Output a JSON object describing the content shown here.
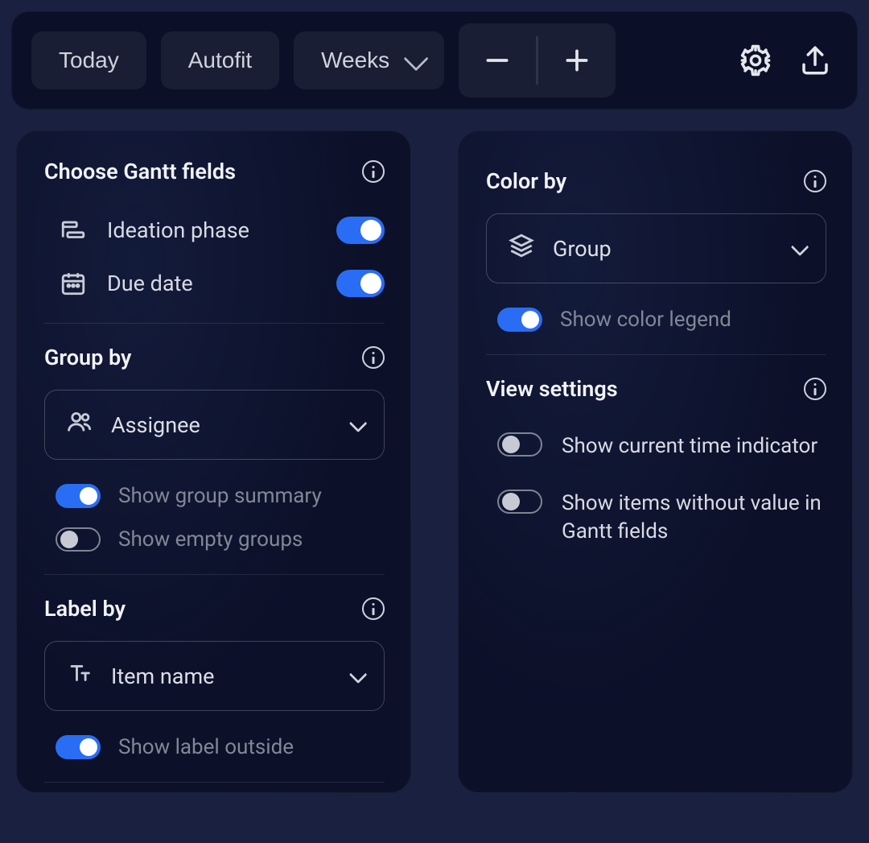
{
  "toolbar": {
    "today_label": "Today",
    "autofit_label": "Autofit",
    "timescale_label": "Weeks"
  },
  "left_panel": {
    "gantt_fields": {
      "title": "Choose Gantt fields",
      "items": [
        {
          "label": "Ideation phase",
          "on": true,
          "icon": "timeline"
        },
        {
          "label": "Due date",
          "on": true,
          "icon": "calendar"
        }
      ]
    },
    "group_by": {
      "title": "Group by",
      "selected": "Assignee",
      "show_group_summary_label": "Show group summary",
      "show_group_summary_on": true,
      "show_empty_groups_label": "Show empty groups",
      "show_empty_groups_on": false
    },
    "label_by": {
      "title": "Label by",
      "selected": "Item name",
      "show_label_outside_label": "Show label outside",
      "show_label_outside_on": true
    }
  },
  "right_panel": {
    "color_by": {
      "title": "Color by",
      "selected": "Group",
      "show_color_legend_label": "Show color legend",
      "show_color_legend_on": true
    },
    "view_settings": {
      "title": "View settings",
      "show_current_time_label": "Show current time indicator",
      "show_current_time_on": false,
      "show_items_without_value_label": "Show items without value in Gantt fields",
      "show_items_without_value_on": false
    }
  },
  "colors": {
    "accent": "#2a6df5",
    "panel_bg": "#0c1029",
    "page_bg": "#1a2040"
  }
}
